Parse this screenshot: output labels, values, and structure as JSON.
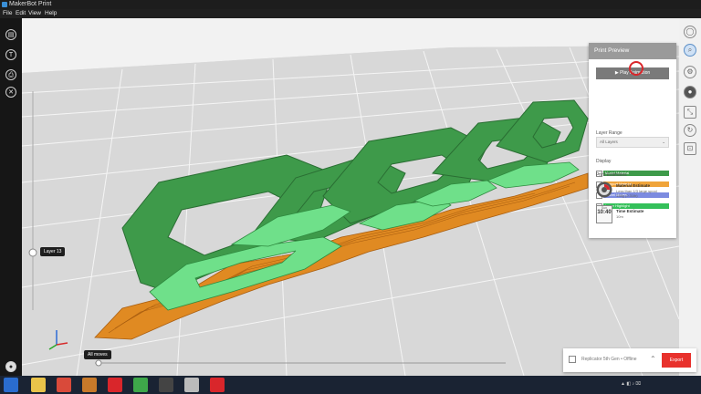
{
  "window": {
    "title": "MakerBot Print"
  },
  "menu": [
    "File",
    "Edit",
    "View",
    "Help"
  ],
  "left_toolbar": [
    {
      "icon": "layers-icon"
    },
    {
      "icon": "text-icon"
    },
    {
      "icon": "print-icon"
    },
    {
      "icon": "close-icon"
    }
  ],
  "viewport": {
    "layer_label": "Layer 13",
    "moves_label": "All moves"
  },
  "print_preview": {
    "title": "Print Preview",
    "play_button": "Play Animation",
    "layer_range_label": "Layer Range",
    "layer_range_value": "All Layers",
    "display_label": "Display",
    "display_items": [
      {
        "label": "Model Material",
        "color": "#3e9a4a",
        "checked": true
      },
      {
        "label": "Support Material",
        "color": "#f0a43a",
        "checked": true
      },
      {
        "label": "Travel Moves",
        "color": "#7c8be0",
        "checked": false
      },
      {
        "label": "Layer Highlight",
        "color": "#34c05a",
        "checked": true
      }
    ],
    "estimates_label": "Print Estimates",
    "material_title": "Material Estimate",
    "material_detail1": "Less than 1/3 large spool",
    "material_detail2": "138g (0.31lb)",
    "time_title": "Time Estimate",
    "time_value": "10:40",
    "time_detail": "10m",
    "time_sub": "Sun"
  },
  "printer_bar": {
    "printer": "Replicator 5th Gen • Offline",
    "export_label": "Export"
  },
  "colors": {
    "model": "#3e9a4a",
    "model_highlight": "#6fe08a",
    "support": "#e08a22",
    "accent_red": "#e8312c",
    "floor": "#d8d8d8",
    "grid": "#ffffff"
  }
}
